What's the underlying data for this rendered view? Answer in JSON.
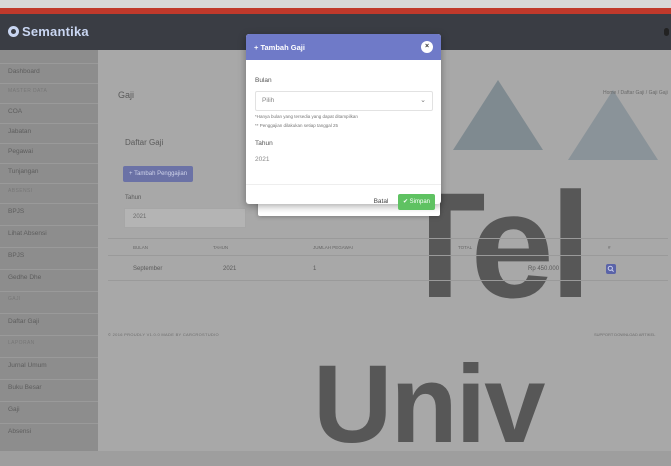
{
  "app": {
    "brand": "Semantika"
  },
  "sidebar": {
    "items": [
      {
        "label": "Dashboard",
        "head": false
      },
      {
        "label": "MASTER DATA",
        "head": true
      },
      {
        "label": "COA",
        "head": false
      },
      {
        "label": "Jabatan",
        "head": false
      },
      {
        "label": "Pegawai",
        "head": false
      },
      {
        "label": "Tunjangan",
        "head": false
      },
      {
        "label": "ABSENSI",
        "head": true
      },
      {
        "label": "BPJS",
        "head": false
      },
      {
        "label": "Lihat Absensi",
        "head": false
      },
      {
        "label": "BPJS",
        "head": false
      },
      {
        "label": "Gedhe Dhe",
        "head": false
      },
      {
        "label": "GAJI",
        "head": true
      },
      {
        "label": "Daftar Gaji",
        "head": false
      },
      {
        "label": "LAPORAN",
        "head": true
      },
      {
        "label": "Jurnal Umum",
        "head": false
      },
      {
        "label": "Buku Besar",
        "head": false
      },
      {
        "label": "Gaji",
        "head": false
      },
      {
        "label": "Absensi",
        "head": false
      }
    ]
  },
  "page": {
    "title": "Gaji",
    "breadcrumb": "Home / Daftar Gaji / Gaji Gaji",
    "card_title": "Daftar Gaji",
    "add_button": "+ Tambah Penggajian",
    "filter_label": "Tahun",
    "filter_value": "2021",
    "table": {
      "headers": [
        "BULAN",
        "TAHUN",
        "JUMLAH PEGAWAI",
        "TOTAL",
        "#"
      ],
      "rows": [
        {
          "bulan": "September",
          "tahun": "2021",
          "jumlah": "1",
          "total": "Rp 450.000"
        }
      ]
    },
    "footer_left": "© 2016 PROUDLY V1.0.0 MADE BY CARCROSTUDIO",
    "footer_right": "SUPPORT   DOWNLOAD   ARTIKEL",
    "watermark_line1": "Tel",
    "watermark_line2": "Univ"
  },
  "modal": {
    "title": "+ Tambah Gaji",
    "close": "×",
    "bulan_label": "Bulan",
    "bulan_value": "Pilih",
    "note1": "*Hanya bulan yang tersedia yang dapat ditampilkan",
    "note2": "** Penggajian dilakukan setiap tanggal 25",
    "tahun_label": "Tahun",
    "tahun_value": "2021",
    "btn_batal": "Batal",
    "btn_simpan": "✔ Simpan"
  },
  "colors": {
    "header": "#3a3d44",
    "modal_header": "#6f7ac8",
    "accent_green": "#5fc262",
    "primary_blue": "#6b72a6"
  }
}
